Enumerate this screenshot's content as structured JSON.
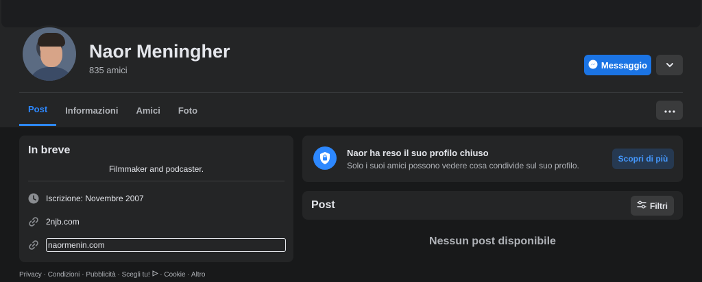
{
  "profile": {
    "name": "Naor Meningher",
    "friends": "835 amici",
    "message_label": "Messaggio"
  },
  "tabs": [
    {
      "label": "Post",
      "active": true
    },
    {
      "label": "Informazioni",
      "active": false
    },
    {
      "label": "Amici",
      "active": false
    },
    {
      "label": "Foto",
      "active": false
    }
  ],
  "intro": {
    "title": "In breve",
    "bio": "Filmmaker and podcaster.",
    "joined": "Iscrizione: Novembre 2007",
    "link1": "2njb.com",
    "link2": "naormenin.com"
  },
  "private_notice": {
    "title": "Naor ha reso il suo profilo chiuso",
    "subtitle": "Solo i suoi amici possono vedere cosa condivide sul suo profilo.",
    "learn_more": "Scopri di più"
  },
  "posts": {
    "title": "Post",
    "filter_label": "Filtri",
    "empty": "Nessun post disponibile"
  },
  "footer": {
    "privacy": "Privacy",
    "terms": "Condizioni",
    "ads": "Pubblicità",
    "ad_choices": "Scegli tu!",
    "cookie": "Cookie",
    "more": "Altro",
    "separator": "·"
  },
  "colors": {
    "accent": "#2d88ff",
    "button_primary": "#1b74e4",
    "background": "#18191a",
    "card": "#242526"
  }
}
